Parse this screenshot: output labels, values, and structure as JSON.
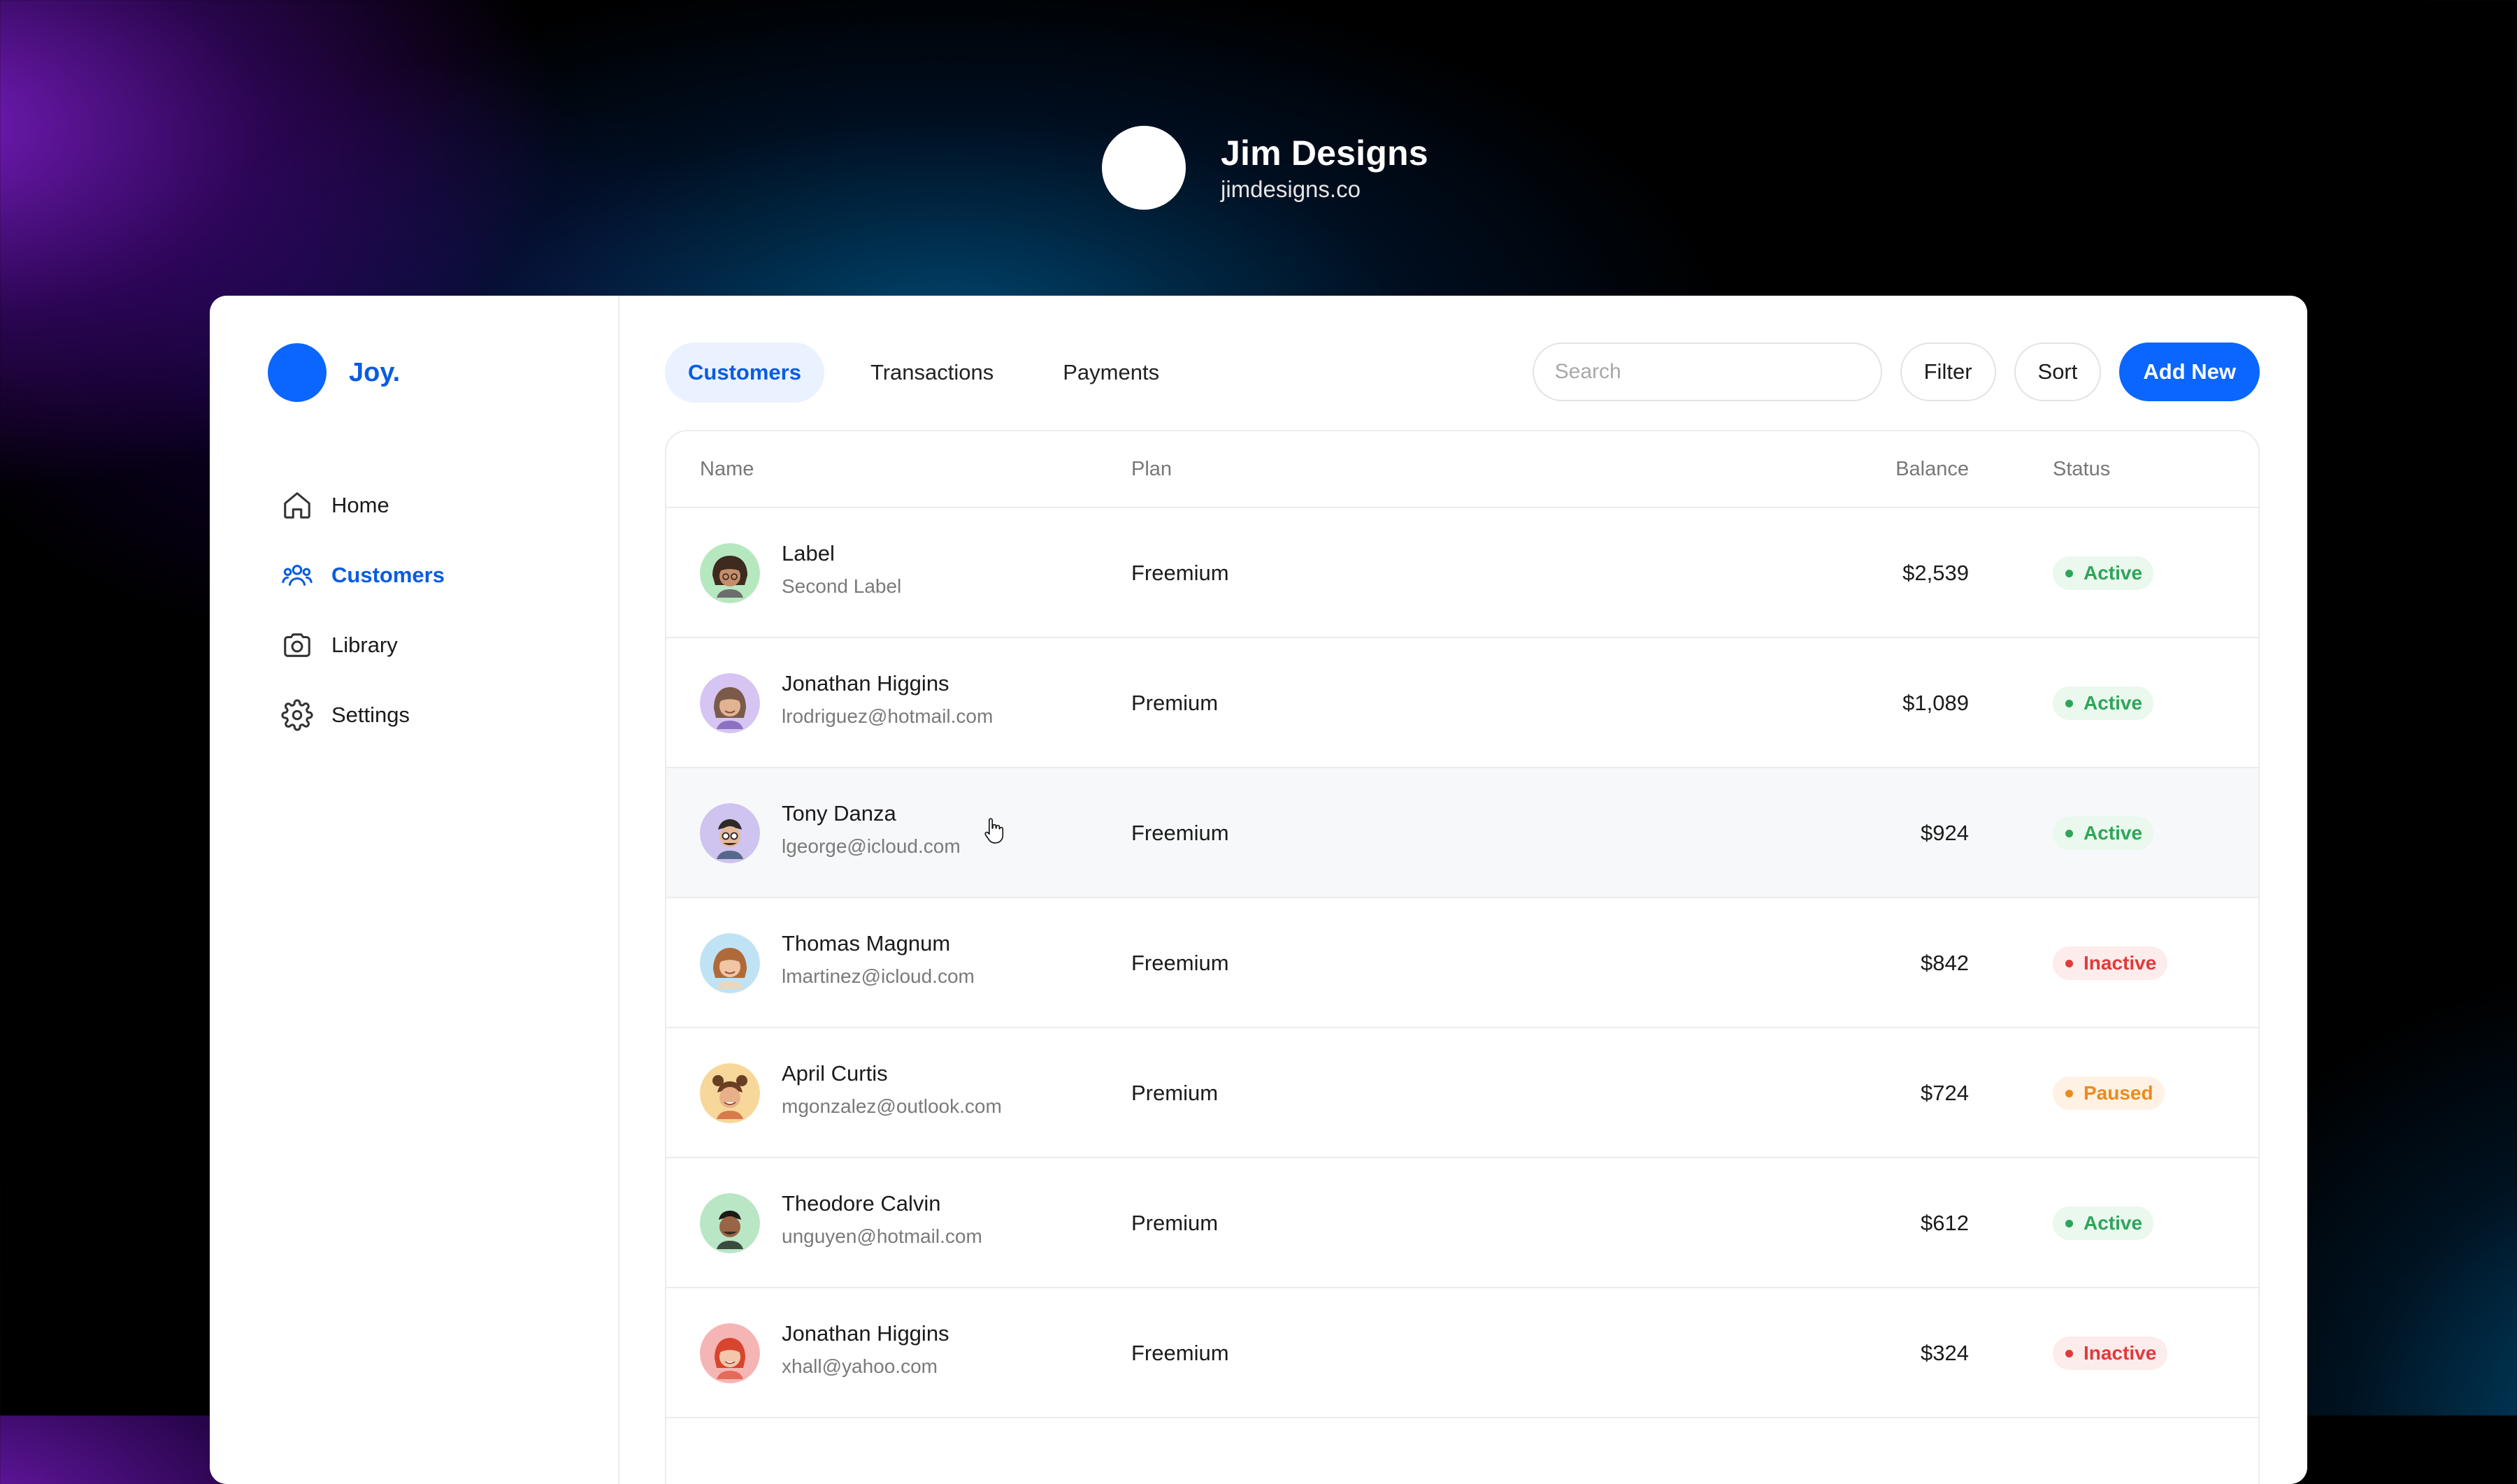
{
  "brand": {
    "name": "Jim Designs",
    "url": "jimdesigns.co"
  },
  "app": {
    "logo_text": "Joy.",
    "accent": "#0a66ff"
  },
  "sidebar": {
    "items": [
      {
        "label": "Home",
        "icon": "home-icon",
        "active": false
      },
      {
        "label": "Customers",
        "icon": "users-icon",
        "active": true
      },
      {
        "label": "Library",
        "icon": "camera-icon",
        "active": false
      },
      {
        "label": "Settings",
        "icon": "gear-icon",
        "active": false
      }
    ]
  },
  "tabs": [
    {
      "label": "Customers",
      "active": true
    },
    {
      "label": "Transactions",
      "active": false
    },
    {
      "label": "Payments",
      "active": false
    }
  ],
  "toolbar": {
    "search_placeholder": "Search",
    "filter_label": "Filter",
    "sort_label": "Sort",
    "add_label": "Add New"
  },
  "table": {
    "columns": {
      "name": "Name",
      "plan": "Plan",
      "balance": "Balance",
      "status": "Status"
    },
    "rows": [
      {
        "name": "Label",
        "email": "Second Label",
        "plan": "Freemium",
        "balance": "$2,539",
        "status": "Active",
        "avatar": "avatar-green"
      },
      {
        "name": "Jonathan Higgins",
        "email": "lrodriguez@hotmail.com",
        "plan": "Premium",
        "balance": "$1,089",
        "status": "Active",
        "avatar": "avatar-purple"
      },
      {
        "name": "Tony Danza",
        "email": "lgeorge@icloud.com",
        "plan": "Freemium",
        "balance": "$924",
        "status": "Active",
        "avatar": "avatar-lavender"
      },
      {
        "name": "Thomas Magnum",
        "email": "lmartinez@icloud.com",
        "plan": "Freemium",
        "balance": "$842",
        "status": "Inactive",
        "avatar": "avatar-blue"
      },
      {
        "name": "April Curtis",
        "email": "mgonzalez@outlook.com",
        "plan": "Premium",
        "balance": "$724",
        "status": "Paused",
        "avatar": "avatar-yellow"
      },
      {
        "name": "Theodore Calvin",
        "email": "unguyen@hotmail.com",
        "plan": "Premium",
        "balance": "$612",
        "status": "Active",
        "avatar": "avatar-mint"
      },
      {
        "name": "Jonathan Higgins",
        "email": "xhall@yahoo.com",
        "plan": "Freemium",
        "balance": "$324",
        "status": "Inactive",
        "avatar": "avatar-pink"
      }
    ]
  },
  "status_colors": {
    "Active": "#2ea559",
    "Inactive": "#e03a3a",
    "Paused": "#ec8a1c"
  }
}
